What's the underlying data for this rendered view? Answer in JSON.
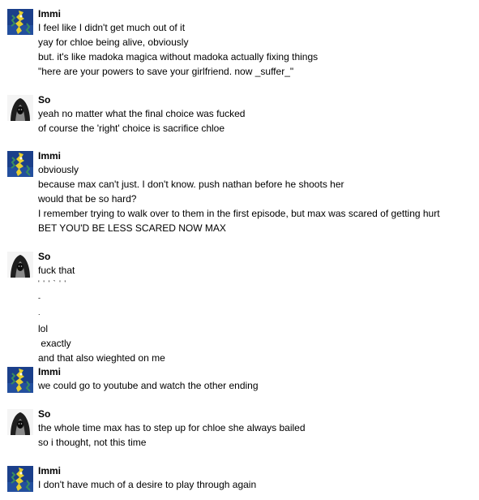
{
  "users": {
    "immi": {
      "name": "Immi",
      "avatar_icon": "immi-avatar-icon",
      "avatar_colors": [
        "#1b3f8a",
        "#e6cf2e",
        "#3a8e5c"
      ]
    },
    "so": {
      "name": "So",
      "avatar_icon": "so-avatar-icon",
      "avatar_colors": [
        "#f4f4f4",
        "#1e1e1e",
        "#8a8a8a"
      ]
    }
  },
  "messages": [
    {
      "sender": "Immi",
      "lines": [
        "I feel like I didn't get much out of it",
        "yay for chloe being alive, obviously",
        "but. it's like madoka magica without madoka actually fixing things",
        "\"here are your powers to save your girlfriend. now _suffer_\""
      ]
    },
    {
      "sender": "So",
      "lines": [
        "yeah no matter what the final choice was fucked",
        "of course the 'right' choice is sacrifice chloe"
      ]
    },
    {
      "sender": "Immi",
      "lines": [
        "obviously",
        "because max can't just. I don't know. push nathan before he shoots her",
        "would that be so hard?",
        "I remember trying to walk over to them in the first episode, but max was scared of getting hurt",
        "BET YOU'D BE LESS SCARED NOW MAX"
      ]
    },
    {
      "sender": "So",
      "lines": [
        "fuck that",
        "' ' ' ` ' '",
        "-",
        ".",
        "lol",
        " exactly",
        "and that also wieghted on me"
      ]
    },
    {
      "sender": "Immi",
      "lines": [
        "we could go to youtube and watch the other ending"
      ]
    },
    {
      "sender": "So",
      "lines": [
        "the whole time max has to step up for chloe she always bailed",
        "so i thought, not this time"
      ]
    },
    {
      "sender": "Immi",
      "lines": [
        "I don't have much of a desire to play through again"
      ]
    }
  ]
}
